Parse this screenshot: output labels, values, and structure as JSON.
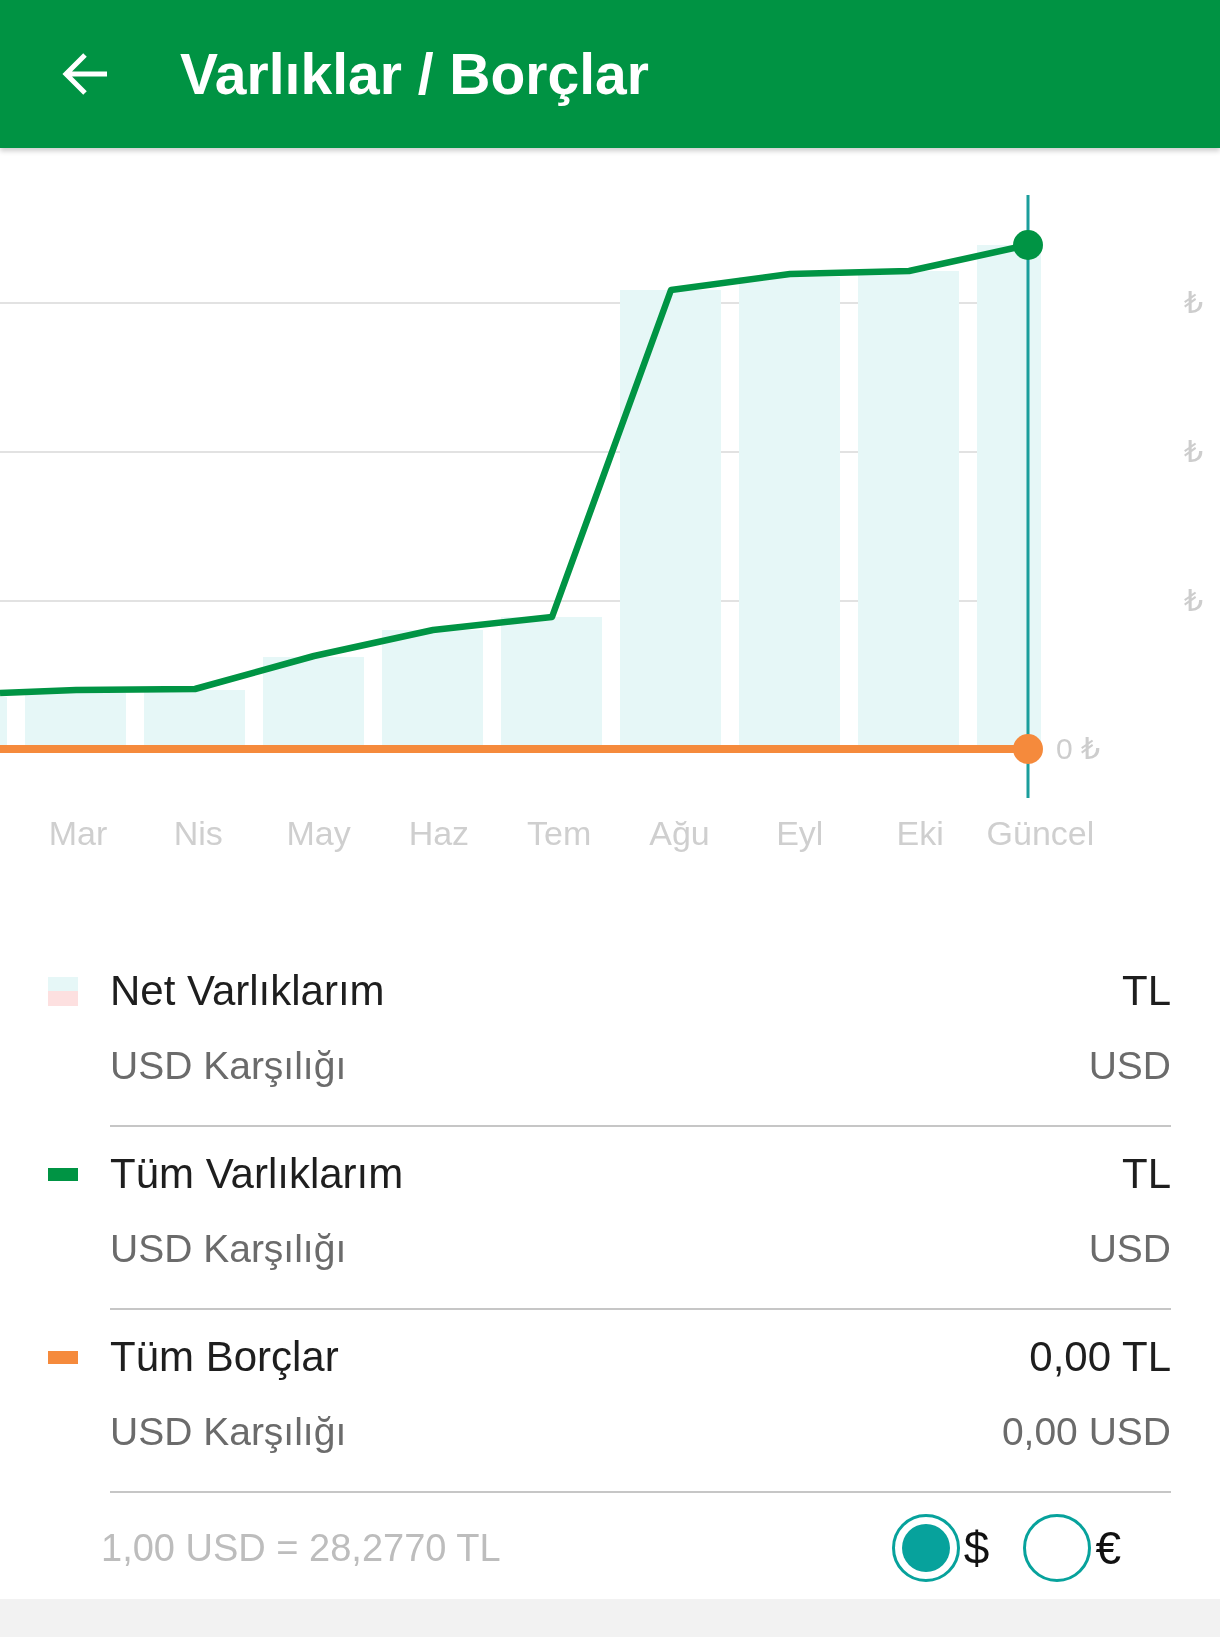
{
  "header": {
    "title": "Varlıklar / Borçlar"
  },
  "chart": {
    "y_labels": [
      "₺",
      "₺",
      "₺",
      "0 ₺"
    ],
    "x_labels": [
      "Mar",
      "Nis",
      "May",
      "Haz",
      "Tem",
      "Ağu",
      "Eyl",
      "Eki",
      "Güncel"
    ]
  },
  "legend": [
    {
      "kind": "split",
      "label": "Net Varlıklarım",
      "swatches": [
        {
          "color": "#e6f7f7"
        },
        {
          "color": "#fde0e0"
        }
      ],
      "value": "TL",
      "sub_label": "USD Karşılığı",
      "sub_value": "USD"
    },
    {
      "kind": "solid",
      "label": "Tüm Varlıklarım",
      "swatches": [
        {
          "color": "#009444"
        }
      ],
      "value": "TL",
      "sub_label": "USD Karşılığı",
      "sub_value": "USD"
    },
    {
      "kind": "solid",
      "label": "Tüm Borçlar",
      "swatches": [
        {
          "color": "#f58a3c"
        }
      ],
      "value": "0,00 TL",
      "sub_label": "USD Karşılığı",
      "sub_value": "0,00 USD"
    }
  ],
  "footer": {
    "rate": "1,00 USD = 28,2770 TL",
    "currencies": [
      {
        "label": "$",
        "selected": true
      },
      {
        "label": "€",
        "selected": false
      }
    ]
  }
}
